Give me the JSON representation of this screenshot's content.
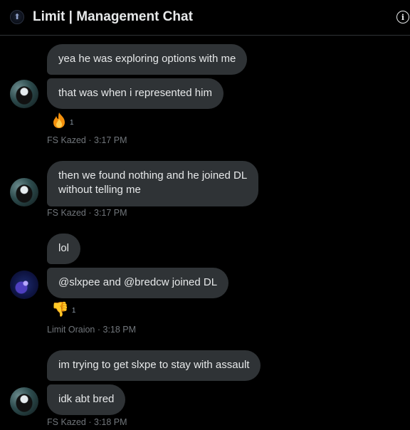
{
  "header": {
    "title": "Limit | Management Chat",
    "info_icon": "i"
  },
  "messages": [
    {
      "id": "m1",
      "text": "yea he was exploring options with me"
    },
    {
      "id": "m2",
      "text": "that was when i represented him"
    },
    {
      "id": "m3",
      "text": "then we found nothing and he joined DL without telling me",
      "line1": "then we found nothing and he joined DL",
      "line2": "without telling me"
    },
    {
      "id": "m4",
      "text": "lol"
    },
    {
      "id": "m5",
      "text": "@slxpee and @bredcw joined DL"
    },
    {
      "id": "m6",
      "text": "im trying to get slxpe to stay with assault"
    },
    {
      "id": "m7",
      "text": "idk abt bred"
    }
  ],
  "reactions": [
    {
      "for": "m2",
      "icon": "fire-emoji",
      "count": "1"
    },
    {
      "for": "m5",
      "icon": "thumbs-down-emoji",
      "count": "1"
    }
  ],
  "meta": [
    {
      "text": "FS Kazed · 3:17 PM"
    },
    {
      "text": "FS Kazed · 3:17 PM"
    },
    {
      "text": "Limit Oraion · 3:18 PM"
    },
    {
      "text": "FS Kazed · 3:18 PM"
    }
  ],
  "colors": {
    "background": "#000000",
    "bubble": "#2f3336",
    "text": "#e7e9ea",
    "meta": "#71767b",
    "divider": "#2f3336"
  }
}
